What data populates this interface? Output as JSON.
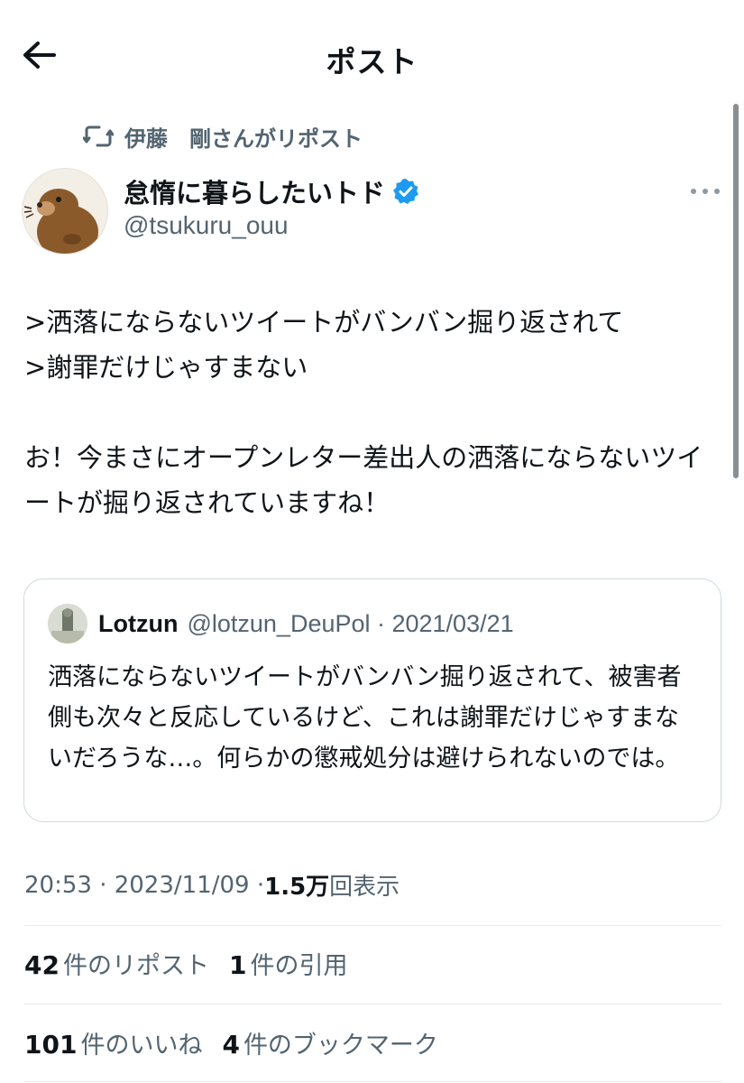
{
  "header": {
    "title": "ポスト",
    "back_icon": "back-arrow-icon"
  },
  "repost_banner": {
    "text": "伊藤　剛さんがリポスト",
    "icon": "repost-icon"
  },
  "author": {
    "name": "怠惰に暮らしたいトド",
    "handle": "@tsukuru_ouu",
    "verified_color": "#1d9bf0",
    "more_icon": "more-dots-icon"
  },
  "tweet": {
    "lines": [
      ">洒落にならないツイートがバンバン掘り返されて",
      ">謝罪だけじゃすまない",
      "お！今まさにオープンレター差出人の洒落にならないツイートが掘り返されていますね！"
    ]
  },
  "quote": {
    "name": "Lotzun",
    "meta": "@lotzun_DeuPol · 2021/03/21",
    "text": "洒落にならないツイートがバンバン掘り返されて、被害者側も次々と反応しているけど、これは謝罪だけじゃすまないだろうな…。何らかの懲戒処分は避けられないのでは。"
  },
  "meta": {
    "time_date": "20:53 · 2023/11/09 · ",
    "views_count": "1.5万",
    "views_label": "回表示"
  },
  "stats": {
    "reposts_count": "42",
    "reposts_label": "件のリポスト",
    "quotes_count": "1",
    "quotes_label": "件の引用",
    "likes_count": "101",
    "likes_label": "件のいいね",
    "bookmarks_count": "4",
    "bookmarks_label": "件のブックマーク"
  },
  "colors": {
    "text": "#0f1419",
    "secondary": "#536471",
    "border": "#cfd9de",
    "accent": "#1d9bf0"
  }
}
